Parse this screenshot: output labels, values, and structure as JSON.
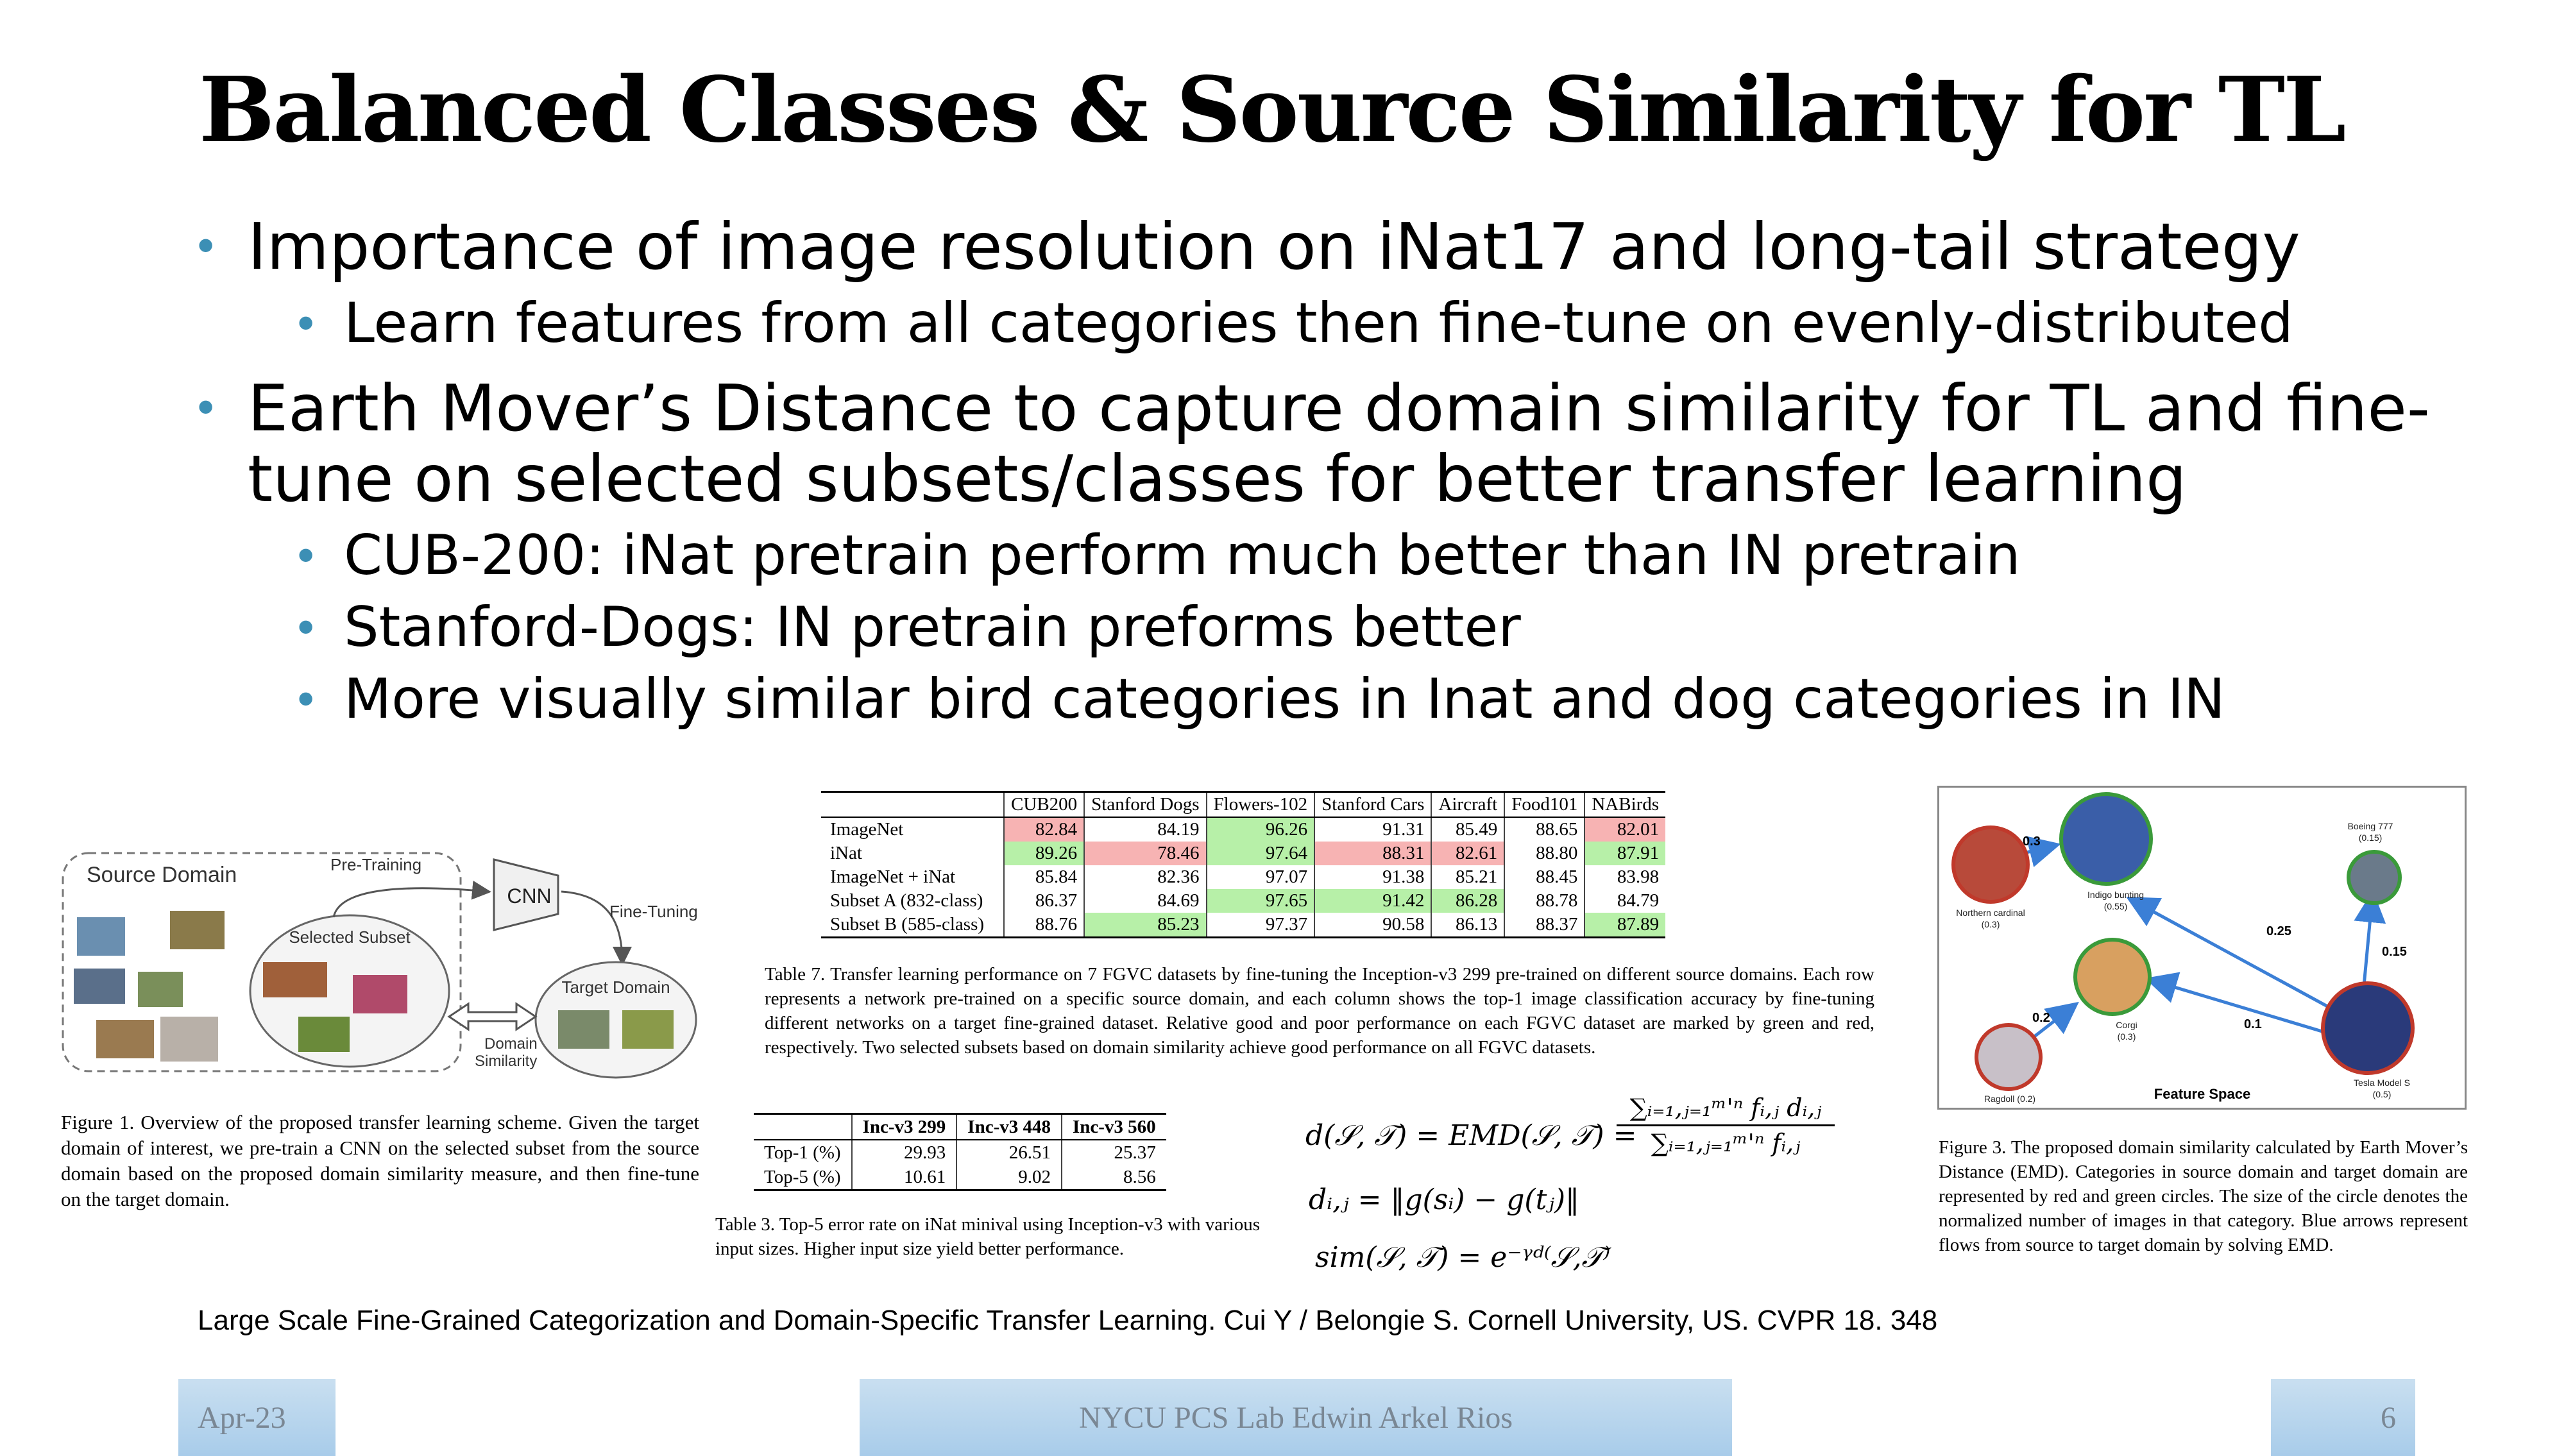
{
  "slide": {
    "title": "Balanced Classes & Source Similarity for TL",
    "bullets": [
      {
        "text": "Importance of image resolution on iNat17 and long-tail strategy",
        "sub": [
          "Learn features from all categories then fine-tune on evenly-distributed"
        ]
      },
      {
        "text": "Earth Mover’s Distance to capture domain similarity for TL and fine-tune on selected subsets/classes for better transfer learning",
        "sub": [
          "CUB-200: iNat pretrain perform much better than IN pretrain",
          "Stanford-Dogs: IN pretrain preforms better",
          "More visually similar bird categories in Inat and dog categories in IN"
        ]
      }
    ],
    "reference": "Large Scale Fine-Grained Categorization and Domain-Specific Transfer Learning. Cui Y / Belongie S. Cornell University, US. CVPR 18. 348",
    "footer": {
      "date": "Apr-23",
      "center": "NYCU PCS Lab Edwin Arkel Rios",
      "page": "6"
    }
  },
  "figure1": {
    "source_domain": "Source Domain",
    "pretraining": "Pre-Training",
    "cnn": "CNN",
    "finetuning": "Fine-Tuning",
    "selected_subset": "Selected Subset",
    "target_domain": "Target Domain",
    "domain_similarity_1": "Domain",
    "domain_similarity_2": "Similarity",
    "caption": "Figure 1. Overview of the proposed transfer learning scheme. Given the target domain of interest, we pre-train a CNN on the selected subset from the source domain based on the proposed domain similarity measure, and then fine-tune on the target domain."
  },
  "table7": {
    "headers": [
      "",
      "CUB200",
      "Stanford Dogs",
      "Flowers-102",
      "Stanford Cars",
      "Aircraft",
      "Food101",
      "NABirds"
    ],
    "rows": [
      {
        "cells": [
          "ImageNet",
          "82.84",
          "84.19",
          "96.26",
          "91.31",
          "85.49",
          "88.65",
          "82.01"
        ],
        "colors": [
          "",
          "r",
          "",
          "g",
          "",
          "",
          "",
          "r"
        ]
      },
      {
        "cells": [
          "iNat",
          "89.26",
          "78.46",
          "97.64",
          "88.31",
          "82.61",
          "88.80",
          "87.91"
        ],
        "colors": [
          "",
          "g",
          "r",
          "g",
          "r",
          "r",
          "",
          "g"
        ]
      },
      {
        "cells": [
          "ImageNet + iNat",
          "85.84",
          "82.36",
          "97.07",
          "91.38",
          "85.21",
          "88.45",
          "83.98"
        ],
        "colors": [
          "",
          "",
          "",
          "",
          "",
          "",
          "",
          ""
        ]
      },
      {
        "cells": [
          "Subset A (832-class)",
          "86.37",
          "84.69",
          "97.65",
          "91.42",
          "86.28",
          "88.78",
          "84.79"
        ],
        "colors": [
          "",
          "",
          "",
          "g",
          "g",
          "g",
          "",
          ""
        ]
      },
      {
        "cells": [
          "Subset B (585-class)",
          "88.76",
          "85.23",
          "97.37",
          "90.58",
          "86.13",
          "88.37",
          "87.89"
        ],
        "colors": [
          "",
          "",
          "g",
          "",
          "",
          "",
          "",
          "g"
        ]
      }
    ],
    "caption": "Table 7. Transfer learning performance on 7 FGVC datasets by fine-tuning the Inception-v3 299 pre-trained on different source domains. Each row represents a network pre-trained on a specific source domain, and each column shows the top-1 image classification accuracy by fine-tuning different networks on a target fine-grained dataset. Relative good and poor performance on each FGVC dataset are marked by green and red, respectively. Two selected subsets based on domain similarity achieve good performance on all FGVC datasets."
  },
  "table3": {
    "headers": [
      "",
      "Inc-v3 299",
      "Inc-v3 448",
      "Inc-v3 560"
    ],
    "rows": [
      [
        "Top-1 (%)",
        "29.93",
        "26.51",
        "25.37"
      ],
      [
        "Top-5 (%)",
        "10.61",
        "9.02",
        "8.56"
      ]
    ],
    "caption": "Table 3. Top-5 error rate on iNat minival using Inception-v3 with various input sizes. Higher input size yield better performance."
  },
  "equations": {
    "eq1_left": "d(𝒮, 𝒯) = EMD(𝒮, 𝒯) =",
    "eq1_num": "∑ᵢ₌₁,ⱼ₌₁ᵐ'ⁿ fᵢ,ⱼ dᵢ,ⱼ",
    "eq1_den": "∑ᵢ₌₁,ⱼ₌₁ᵐ'ⁿ fᵢ,ⱼ",
    "eq2": "dᵢ,ⱼ = ‖g(sᵢ) − g(tⱼ)‖",
    "eq3": "sim(𝒮, 𝒯) = e⁻ᵞᵈ⁽𝒮,𝒯⁾"
  },
  "figure3": {
    "nodes": [
      {
        "label": "Northern cardinal",
        "value": "(0.3)",
        "color": "#c0392b"
      },
      {
        "label": "Indigo bunting",
        "value": "(0.55)",
        "color": "#3a9a3a"
      },
      {
        "label": "Boeing 777",
        "value": "(0.15)",
        "color": "#3a9a3a"
      },
      {
        "label": "Corgi",
        "value": "(0.3)",
        "color": "#3a9a3a"
      },
      {
        "label": "Ragdoll (0.2)",
        "value": "",
        "color": "#c0392b"
      },
      {
        "label": "Tesla Model S",
        "value": "(0.5)",
        "color": "#c0392b"
      }
    ],
    "flows": [
      "0.3",
      "0.25",
      "0.15",
      "0.2",
      "0.1"
    ],
    "feature_space": "Feature Space",
    "caption": "Figure 3. The proposed domain similarity calculated by Earth Mover’s Distance (EMD). Categories in source domain and target domain are represented by red and green circles. The size of the circle denotes the normalized number of images in that category. Blue arrows represent flows from source to target domain by solving EMD."
  },
  "colors": {
    "bullet": "#3c8fb5",
    "good": "#b7f0a8",
    "poor": "#f7b3b3",
    "arrow": "#3b7fd6"
  }
}
